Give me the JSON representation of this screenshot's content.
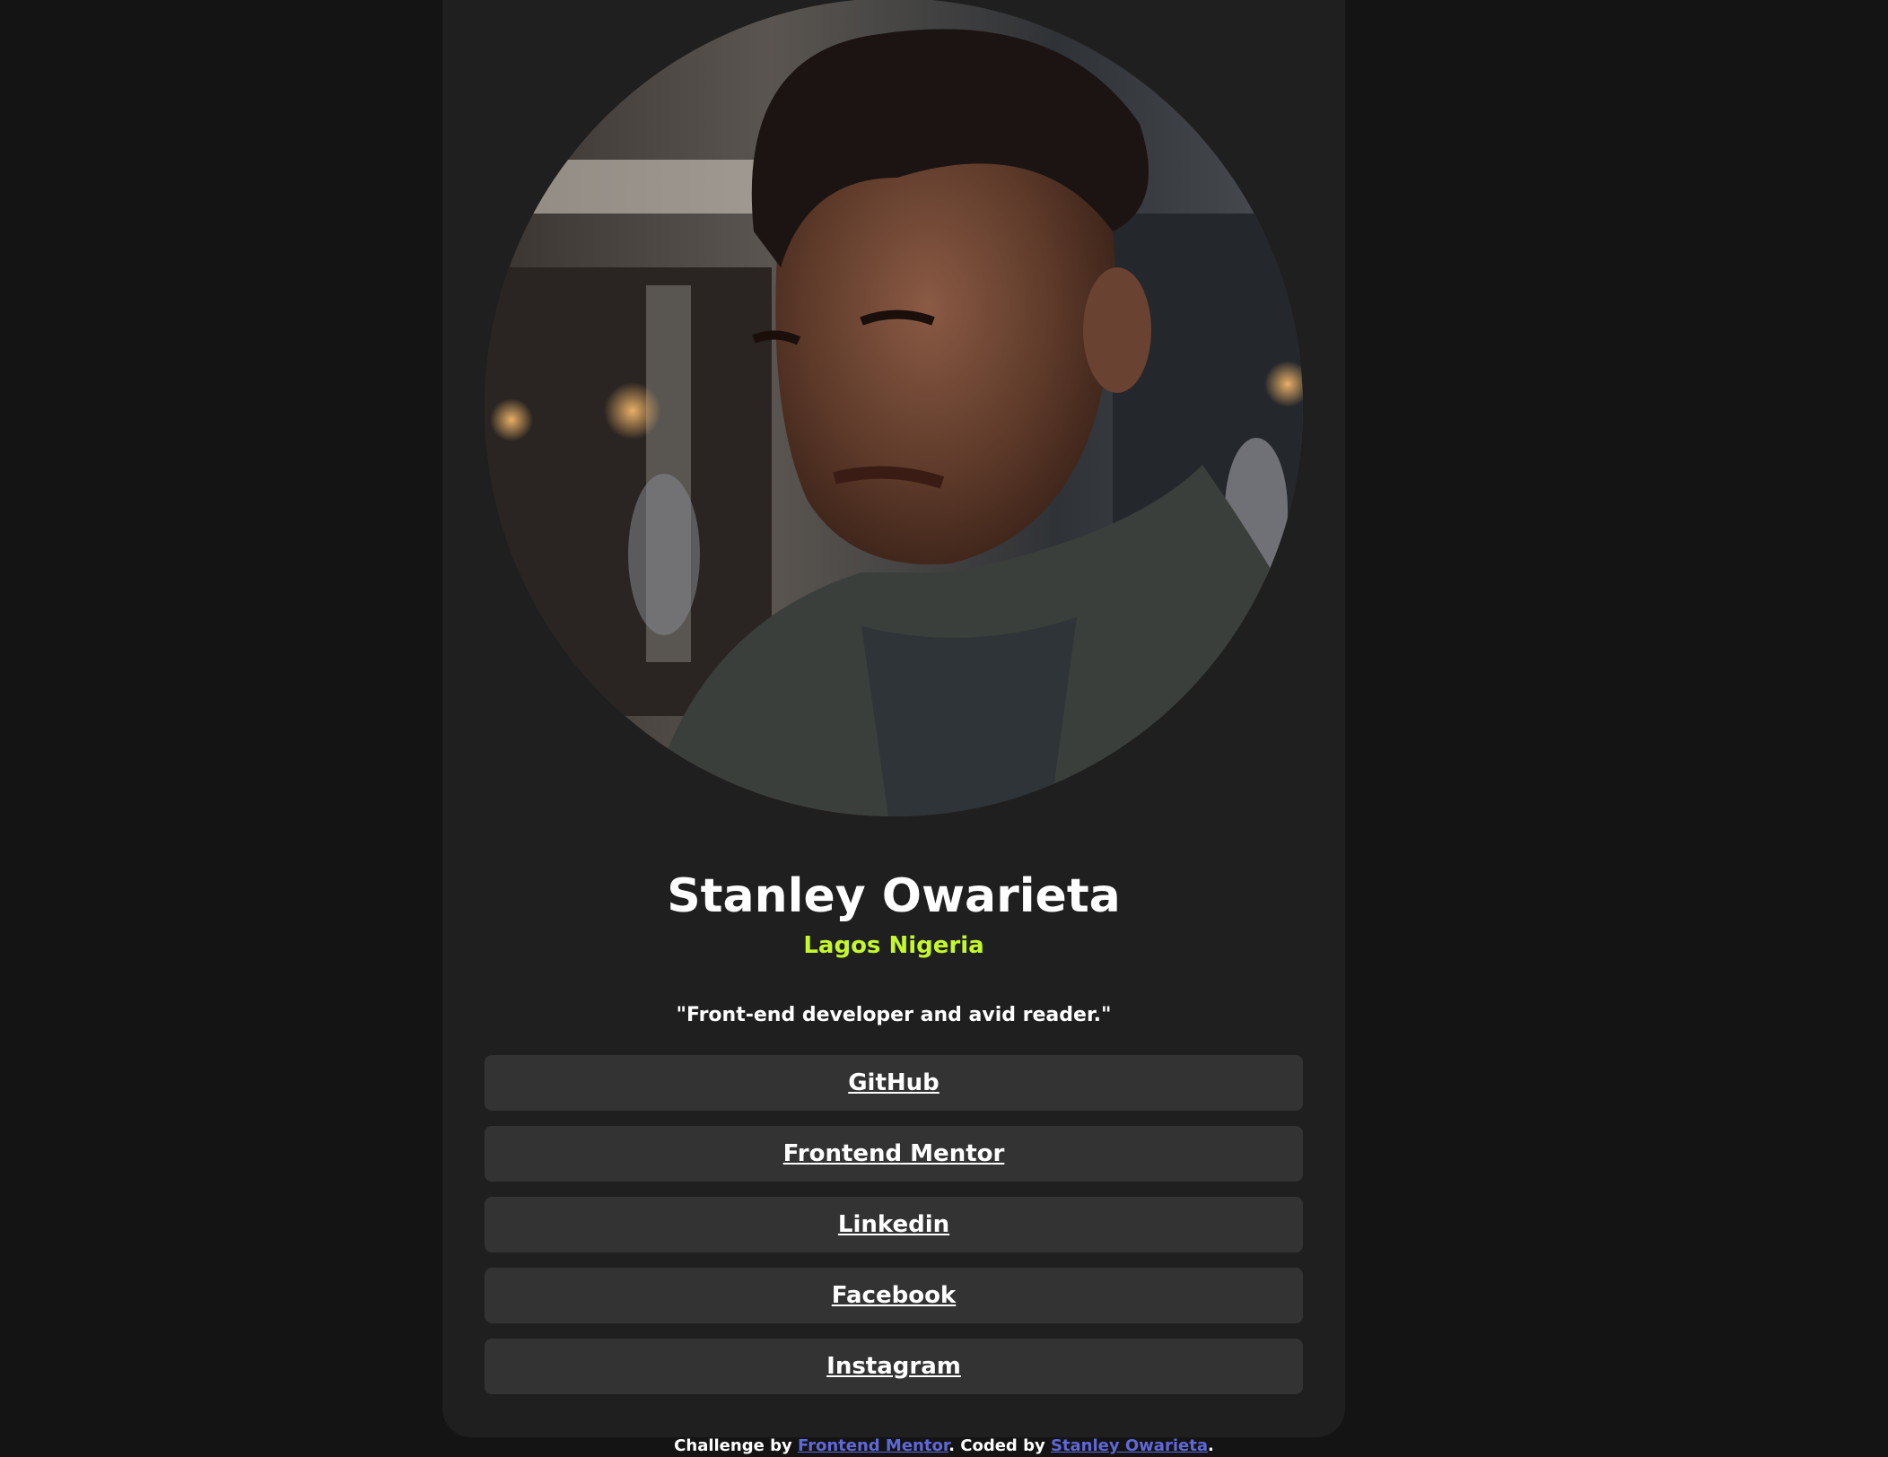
{
  "profile": {
    "name": "Stanley Owarieta",
    "location": "Lagos Nigeria",
    "bio": "\"Front-end developer and avid reader.\"",
    "avatar_alt": "Stanley Owarieta"
  },
  "links": [
    {
      "label": "GitHub"
    },
    {
      "label": "Frontend Mentor"
    },
    {
      "label": "Linkedin"
    },
    {
      "label": "Facebook"
    },
    {
      "label": "Instagram"
    }
  ],
  "footer": {
    "prefix": "Challenge by ",
    "challenge_link": "Frontend Mentor",
    "middle": ". Coded by ",
    "author_link": "Stanley Owarieta",
    "suffix": "."
  },
  "colors": {
    "page_background": "#141414",
    "card_background": "#1f1f1f",
    "link_background": "#333333",
    "accent": "#c4f82a",
    "footer_link": "#6068d8",
    "text": "#ffffff"
  }
}
